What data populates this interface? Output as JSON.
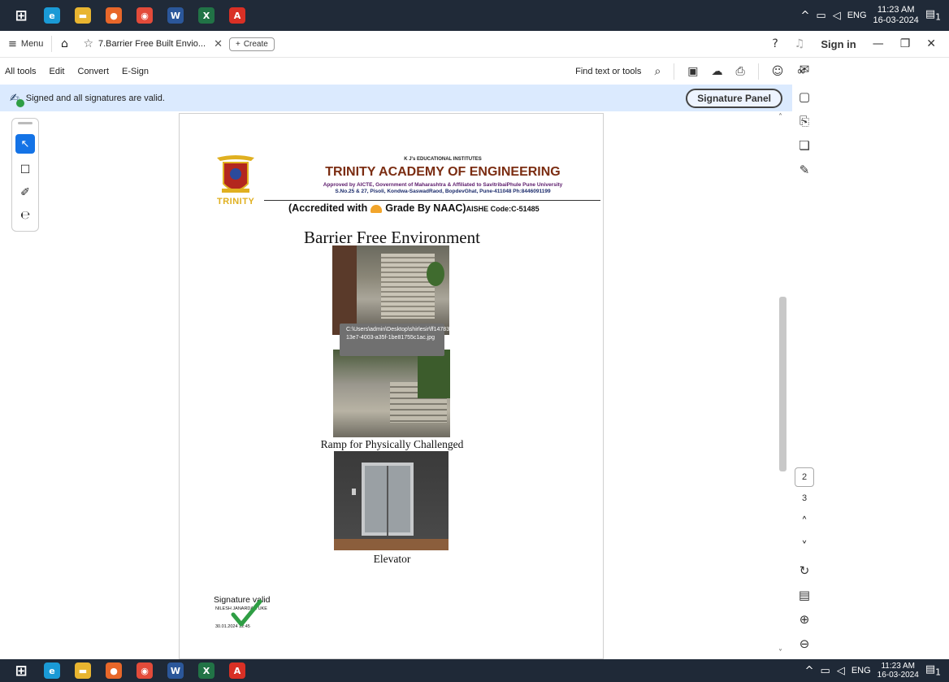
{
  "colors": {
    "accent": "#1473e6",
    "sigbar": "#dbeafe",
    "taskbar": "#1f2937",
    "check": "#2f9e44"
  },
  "os": {
    "taskbar_apps": [
      {
        "name": "windows-start-icon",
        "glyph": "⊞",
        "color": "#ffffff"
      },
      {
        "name": "edge-icon",
        "glyph": "e",
        "color": "#1a9ad6"
      },
      {
        "name": "file-explorer-icon",
        "glyph": "▬",
        "color": "#e8b530"
      },
      {
        "name": "firefox-icon",
        "glyph": "●",
        "color": "#e8672a"
      },
      {
        "name": "chrome-icon",
        "glyph": "◉",
        "color": "#e34b3a"
      },
      {
        "name": "word-icon",
        "glyph": "W",
        "color": "#2b579a"
      },
      {
        "name": "excel-icon",
        "glyph": "X",
        "color": "#217346"
      },
      {
        "name": "acrobat-icon",
        "glyph": "A",
        "color": "#d93025"
      }
    ],
    "tray": {
      "lang": "ENG",
      "time": "11:23 AM",
      "date": "16-03-2024",
      "notif_count": "1"
    }
  },
  "tabs": {
    "menu_label": "Menu",
    "doc_tab_title": "7.Barrier Free Built Envio...",
    "create_label": "Create",
    "signin_label": "Sign in"
  },
  "toolbar": {
    "menu": [
      "All tools",
      "Edit",
      "Convert",
      "E-Sign"
    ],
    "find_label": "Find text or tools"
  },
  "signature_bar": {
    "message": "Signed and all signatures are valid.",
    "panel_button": "Signature Panel"
  },
  "page_nav": {
    "current": "2",
    "next": "3"
  },
  "document": {
    "letterhead": {
      "institute_group": "K J's EDUCATIONAL INSTITUTES",
      "college_name": "TRINITY ACADEMY OF ENGINEERING",
      "approval": "Approved by AICTE, Government of Maharashtra & Affiliated to SavitribaiPhule Pune University",
      "address": "S.No.25 & 27, Pisoli, Kondwa-SaswadRaod, BopdevGhat, Pune-411048 Ph:8446091199",
      "accreditation_a": "(Accredited with",
      "accreditation_b": "Grade By NAAC)",
      "aishe": "AISHE Code:C-51485",
      "crest_word": "TRINITY"
    },
    "title": "Barrier Free Environment",
    "tooltip": "C:\\Users\\admin\\Desktop\\shirlesir\\ff14783-13e7-4003-a35f-1be81755c1ac.jpg",
    "caption_ramp": "Ramp for Physically Challenged",
    "caption_elevator": "Elevator",
    "signature": {
      "status": "Signature valid",
      "signer": "NILESH JANARDAN UKE",
      "date": "30.01.2024 12:45"
    }
  }
}
